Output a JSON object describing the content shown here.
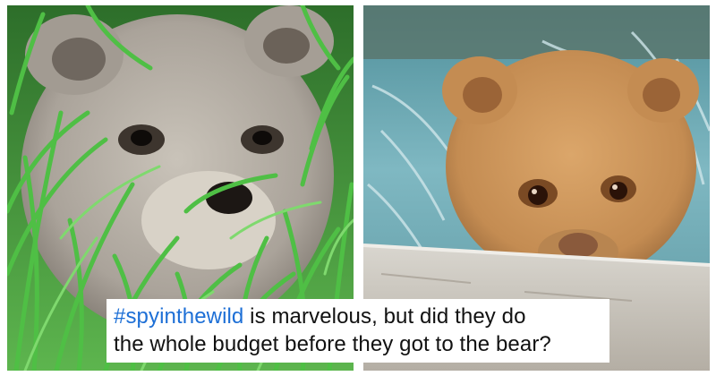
{
  "caption": {
    "hashtag": "#spyinthewild",
    "line1_rest": " is marvelous, but did they do",
    "line2": "the whole budget before they got to the bear?"
  },
  "colors": {
    "hashtag": "#1d6fd6",
    "text": "#111111",
    "grass": "#3fa83a",
    "bear_left": "#b9b3aa",
    "bear_right": "#c9955a",
    "water": "#6aa3b0"
  },
  "images": [
    {
      "icon": "bear-in-grass-photo"
    },
    {
      "icon": "animatronic-bear-cub-photo"
    }
  ]
}
